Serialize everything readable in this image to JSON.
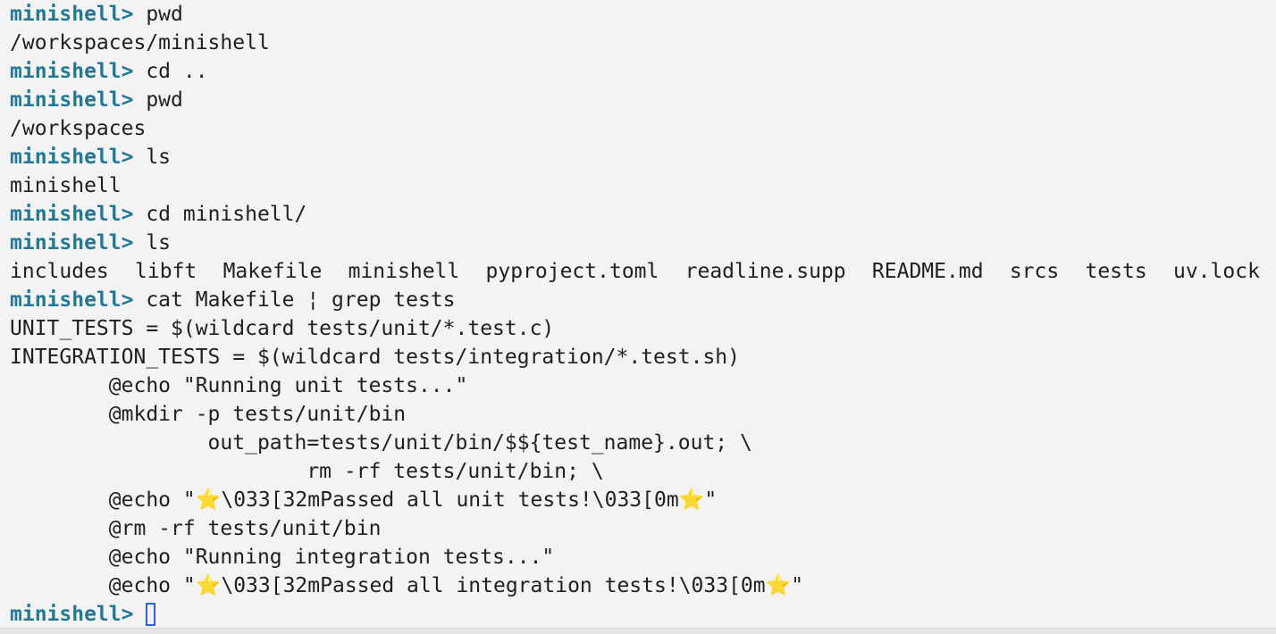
{
  "terminal": {
    "prompt": "minishell> ",
    "colors": {
      "background": "#f3f3f3",
      "prompt": "#237893",
      "text": "#1f1f1f",
      "cursor": "#2f5fd0"
    },
    "lines": [
      {
        "kind": "command",
        "text": "pwd"
      },
      {
        "kind": "output",
        "text": "/workspaces/minishell"
      },
      {
        "kind": "command",
        "text": "cd .."
      },
      {
        "kind": "command",
        "text": "pwd"
      },
      {
        "kind": "output",
        "text": "/workspaces"
      },
      {
        "kind": "command",
        "text": "ls"
      },
      {
        "kind": "output",
        "text": "minishell"
      },
      {
        "kind": "command",
        "text": "cd minishell/"
      },
      {
        "kind": "command",
        "text": "ls"
      },
      {
        "kind": "ls",
        "items": [
          "includes",
          "libft",
          "Makefile",
          "minishell",
          "pyproject.toml",
          "readline.supp",
          "README.md",
          "srcs",
          "tests",
          "uv.lock"
        ]
      },
      {
        "kind": "command",
        "text": "cat Makefile ¦ grep tests"
      },
      {
        "kind": "output",
        "text": "UNIT_TESTS = $(wildcard tests/unit/*.test.c)"
      },
      {
        "kind": "output",
        "text": "INTEGRATION_TESTS = $(wildcard tests/integration/*.test.sh)"
      },
      {
        "kind": "output",
        "text": "        @echo \"Running unit tests...\""
      },
      {
        "kind": "output",
        "text": "        @mkdir -p tests/unit/bin"
      },
      {
        "kind": "output",
        "text": "                out_path=tests/unit/bin/$${test_name}.out; \\"
      },
      {
        "kind": "output",
        "text": "                        rm -rf tests/unit/bin; \\"
      },
      {
        "kind": "output",
        "text": "        @echo \"⭐\\033[32mPassed all unit tests!\\033[0m⭐\""
      },
      {
        "kind": "output",
        "text": "        @rm -rf tests/unit/bin"
      },
      {
        "kind": "output",
        "text": "        @echo \"Running integration tests...\""
      },
      {
        "kind": "output",
        "text": "        @echo \"⭐\\033[32mPassed all integration tests!\\033[0m⭐\""
      },
      {
        "kind": "input",
        "text": ""
      }
    ]
  }
}
